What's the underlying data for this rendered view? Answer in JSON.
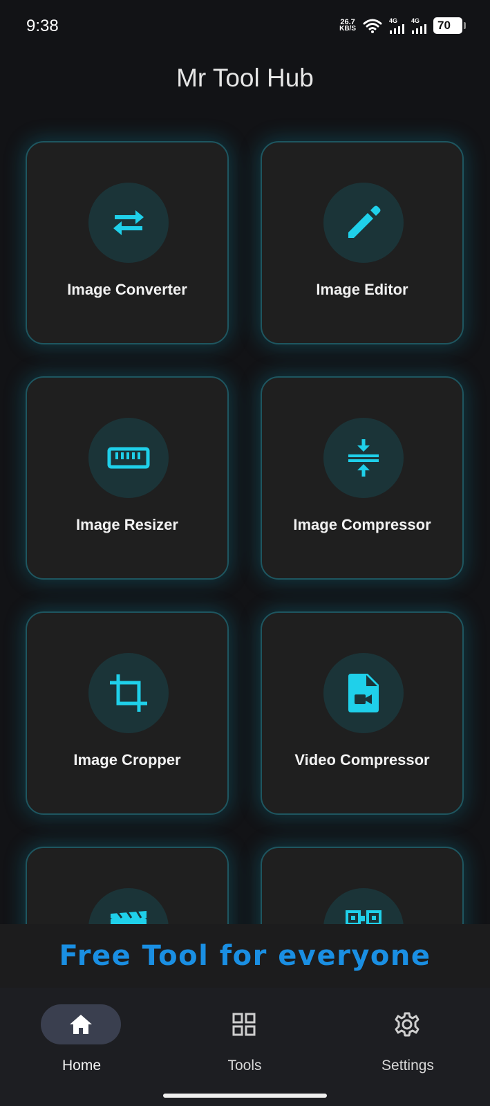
{
  "status_bar": {
    "time": "9:38",
    "net_speed_value": "26.7",
    "net_speed_unit": "KB/S",
    "sim1_label": "4G",
    "sim2_label": "4G",
    "battery": "70",
    "icons": [
      "wifi-icon",
      "signal-icon",
      "signal-icon",
      "battery-icon"
    ]
  },
  "header": {
    "title": "Mr Tool Hub"
  },
  "tools": [
    {
      "label": "Image Converter",
      "icon": "swap-arrows-icon"
    },
    {
      "label": "Image Editor",
      "icon": "pencil-icon"
    },
    {
      "label": "Image Resizer",
      "icon": "ruler-icon"
    },
    {
      "label": "Image Compressor",
      "icon": "compress-icon"
    },
    {
      "label": "Image Cropper",
      "icon": "crop-icon"
    },
    {
      "label": "Video Compressor",
      "icon": "video-file-icon"
    },
    {
      "label": "",
      "icon": "clapperboard-icon"
    },
    {
      "label": "",
      "icon": "qr-code-icon"
    }
  ],
  "banner": {
    "text": "Free Tool for everyone"
  },
  "bottom_nav": {
    "items": [
      {
        "label": "Home",
        "icon": "home-icon",
        "active": true
      },
      {
        "label": "Tools",
        "icon": "grid-icon",
        "active": false
      },
      {
        "label": "Settings",
        "icon": "gear-icon",
        "active": false
      }
    ]
  },
  "colors": {
    "background": "#121316",
    "card": "#1f1f1f",
    "card_border": "#1e5660",
    "accent_icon": "#1fd0ea",
    "banner_text": "#1a8fe3",
    "nav_active_pill": "#3a3f4f"
  }
}
